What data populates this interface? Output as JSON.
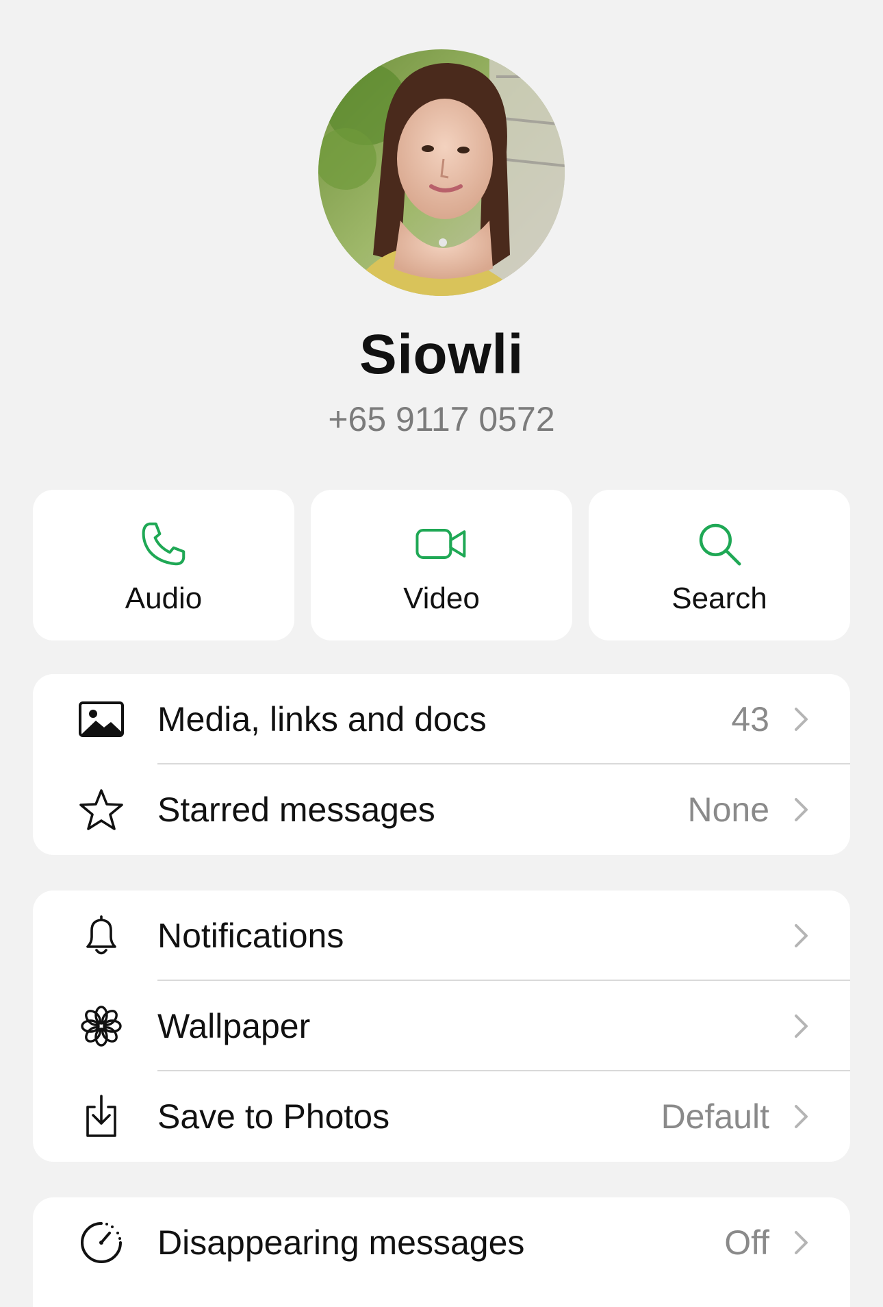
{
  "contact": {
    "name": "Siowli",
    "phone": "+65 9117 0572"
  },
  "actions": [
    {
      "label": "Audio",
      "icon": "phone-icon"
    },
    {
      "label": "Video",
      "icon": "video-camera-icon"
    },
    {
      "label": "Search",
      "icon": "search-icon"
    }
  ],
  "section1": [
    {
      "label": "Media, links and docs",
      "value": "43",
      "icon": "image-icon"
    },
    {
      "label": "Starred messages",
      "value": "None",
      "icon": "star-icon"
    }
  ],
  "section2": [
    {
      "label": "Notifications",
      "value": "",
      "icon": "bell-icon"
    },
    {
      "label": "Wallpaper",
      "value": "",
      "icon": "flower-icon"
    },
    {
      "label": "Save to Photos",
      "value": "Default",
      "icon": "save-download-icon"
    }
  ],
  "section3": [
    {
      "label": "Disappearing messages",
      "value": "Off",
      "icon": "timer-icon"
    }
  ],
  "colors": {
    "accent": "#1fa855",
    "background": "#f2f2f2",
    "card": "#ffffff",
    "secondary_text": "#8a8a8a"
  }
}
